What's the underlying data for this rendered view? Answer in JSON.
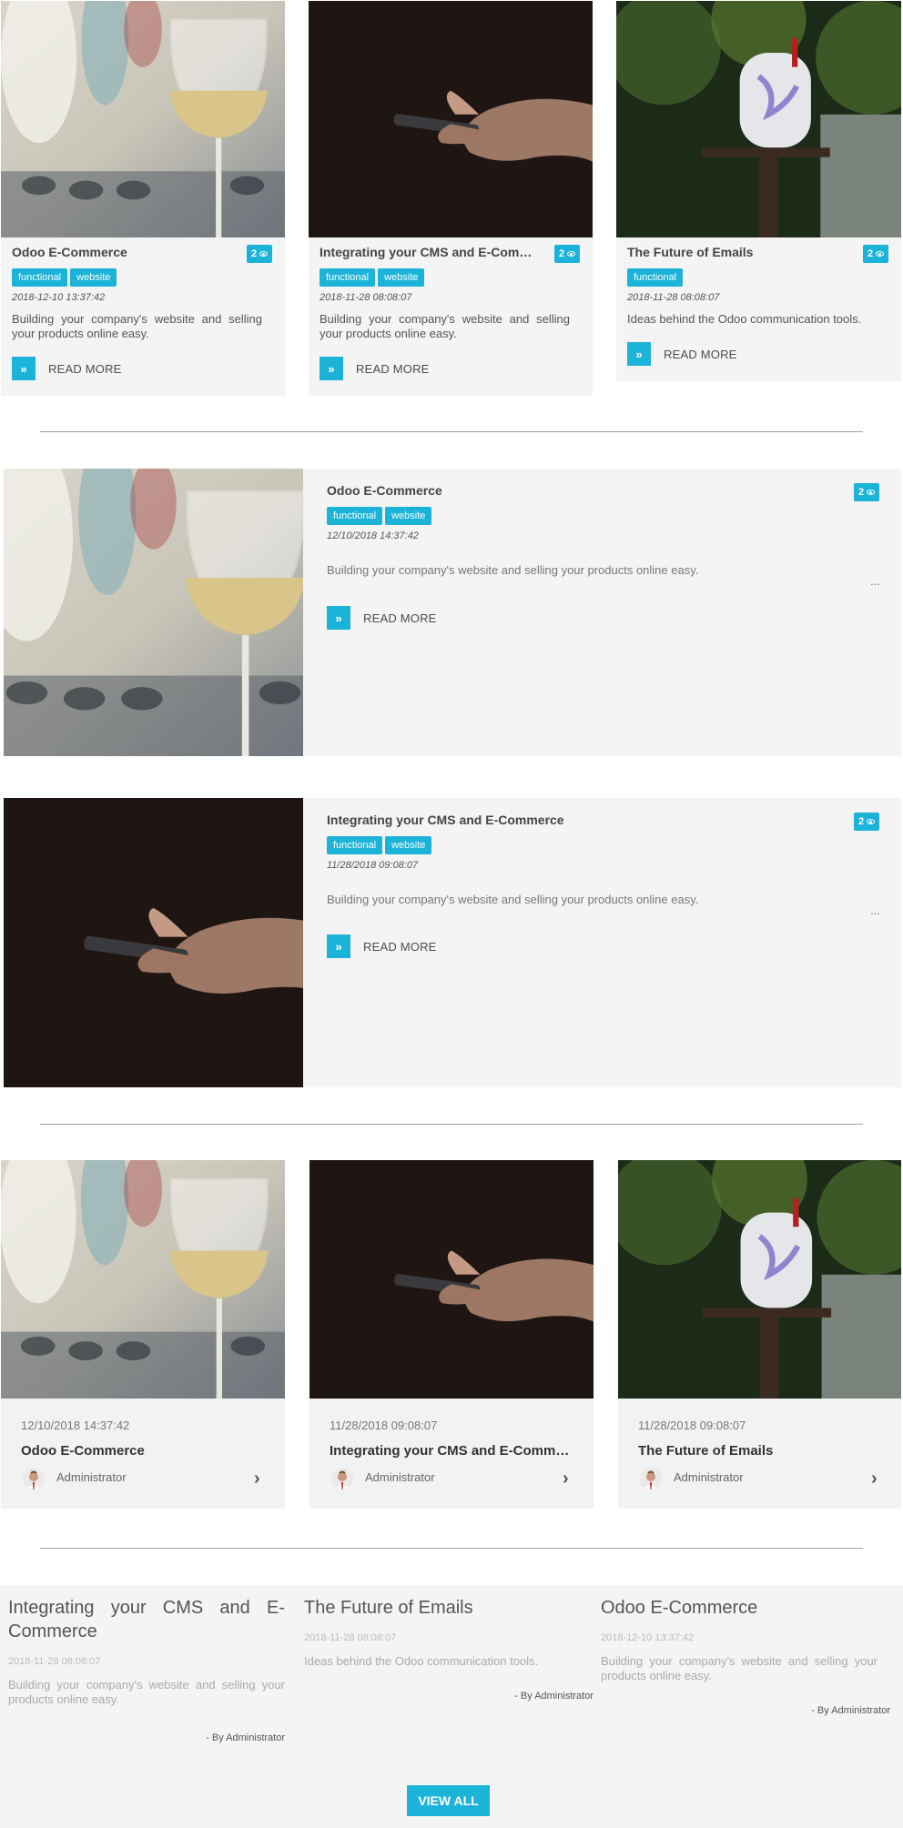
{
  "colors": {
    "accent": "#1cb3d9",
    "card_bg": "#f4f4f4"
  },
  "read_more": "READ MORE",
  "view_all": "VIEW ALL",
  "ellipsis": "...",
  "grid_posts": [
    {
      "title": "Odoo E-Commerce",
      "views": "2",
      "tags": [
        "functional",
        "website"
      ],
      "date": "2018-12-10 13:37:42",
      "desc": "Building your company's website and selling your products online easy."
    },
    {
      "title": "Integrating your CMS and E-Commerce",
      "views": "2",
      "tags": [
        "functional",
        "website"
      ],
      "date": "2018-11-28 08:08:07",
      "desc": "Building your company's website and selling your products online easy."
    },
    {
      "title": "The Future of Emails",
      "views": "2",
      "tags": [
        "functional"
      ],
      "date": "2018-11-28 08:08:07",
      "desc": "Ideas behind the Odoo communication tools."
    }
  ],
  "list_posts": [
    {
      "title": "Odoo E-Commerce",
      "views": "2",
      "tags": [
        "functional",
        "website"
      ],
      "date": "12/10/2018 14:37:42",
      "desc": "Building your company's website and selling your products online easy."
    },
    {
      "title": "Integrating your CMS and E-Commerce",
      "views": "2",
      "tags": [
        "functional",
        "website"
      ],
      "date": "11/28/2018 09:08:07",
      "desc": "Building your company's website and selling your products online easy."
    }
  ],
  "author_posts": [
    {
      "date": "12/10/2018 14:37:42",
      "title": "Odoo E-Commerce",
      "author": "Administrator"
    },
    {
      "date": "11/28/2018 09:08:07",
      "title": "Integrating your CMS and E-Commerce",
      "author": "Administrator"
    },
    {
      "date": "11/28/2018 09:08:07",
      "title": "The Future of Emails",
      "author": "Administrator"
    }
  ],
  "text_posts": [
    {
      "title": "Integrating your CMS and E-Commerce",
      "date": "2018-11-28 08:08:07",
      "desc": "Building your company's website and selling your products online easy.",
      "by": "- By Administrator"
    },
    {
      "title": "The Future of Emails",
      "date": "2018-11-28 08:08:07",
      "desc": "Ideas behind the Odoo communication tools.",
      "by": "- By Administrator"
    },
    {
      "title": "Odoo E-Commerce",
      "date": "2018-12-10 13:37:42",
      "desc": "Building your company's website and selling your products online easy.",
      "by": "- By Administrator"
    }
  ]
}
